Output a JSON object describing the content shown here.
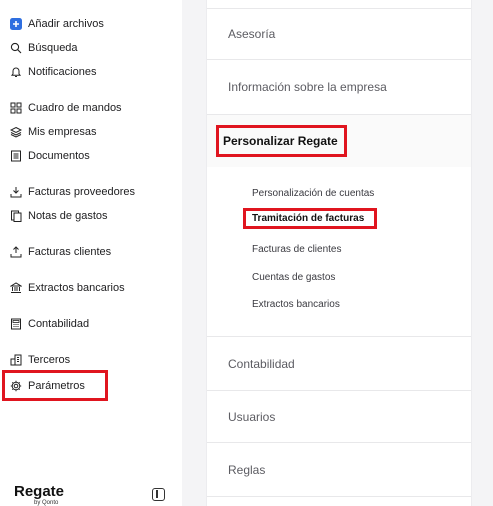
{
  "sidebar": {
    "items": [
      {
        "label": "Añadir archivos",
        "icon": "plus-square-icon"
      },
      {
        "label": "Búsqueda",
        "icon": "search-icon"
      },
      {
        "label": "Notificaciones",
        "icon": "bell-icon"
      },
      {
        "label": "Cuadro de mandos",
        "icon": "dashboard-grid-icon"
      },
      {
        "label": "Mis empresas",
        "icon": "layers-icon"
      },
      {
        "label": "Documentos",
        "icon": "document-icon"
      },
      {
        "label": "Facturas proveedores",
        "icon": "download-tray-icon"
      },
      {
        "label": "Notas de gastos",
        "icon": "receipt-icon"
      },
      {
        "label": "Facturas clientes",
        "icon": "upload-tray-icon"
      },
      {
        "label": "Extractos bancarios",
        "icon": "bank-icon"
      },
      {
        "label": "Contabilidad",
        "icon": "calculator-icon"
      },
      {
        "label": "Terceros",
        "icon": "buildings-icon"
      },
      {
        "label": "Parámetros",
        "icon": "gear-icon"
      }
    ],
    "brand": "Regate",
    "brand_sub": "by Qonto"
  },
  "settings": {
    "sections": [
      {
        "label": "Asesoría"
      },
      {
        "label": "Información sobre la empresa"
      },
      {
        "label": "Personalizar Regate"
      },
      {
        "label": "Contabilidad"
      },
      {
        "label": "Usuarios"
      },
      {
        "label": "Reglas"
      }
    ],
    "sub_items": [
      {
        "label": "Personalización de cuentas"
      },
      {
        "label": "Tramitación de facturas"
      },
      {
        "label": "Facturas de clientes"
      },
      {
        "label": "Cuentas de gastos"
      },
      {
        "label": "Extractos bancarios"
      }
    ]
  },
  "colors": {
    "highlight": "#e0151f",
    "accent": "#1a73e8"
  }
}
